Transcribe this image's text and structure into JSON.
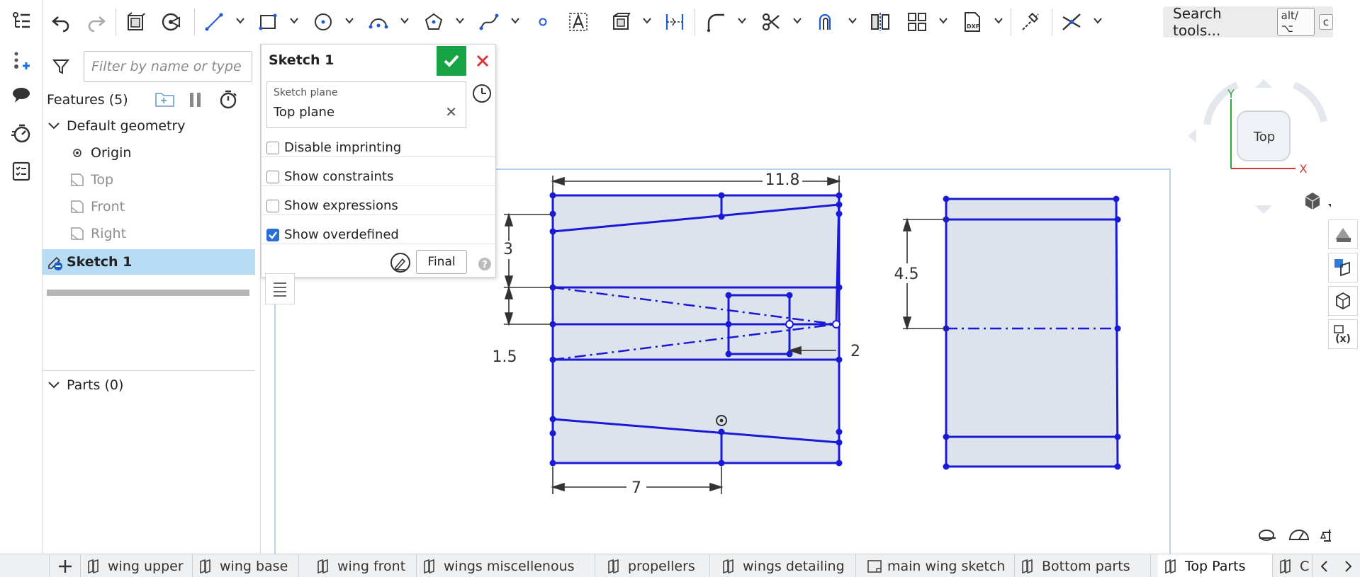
{
  "rail": {
    "items": [
      "feature-list",
      "insert",
      "comments",
      "performance",
      "parts-checklist"
    ]
  },
  "toolbar": {
    "search_label": "Search tools...",
    "search_shortcut_mod": "alt/⌥",
    "search_shortcut_key": "c"
  },
  "feature_panel": {
    "filter_placeholder": "Filter by name or type",
    "features_title": "Features (5)",
    "default_geometry": "Default geometry",
    "origin": "Origin",
    "planes": [
      "Top",
      "Front",
      "Right"
    ],
    "sketch": "Sketch 1",
    "parts_title": "Parts (0)"
  },
  "sketch_dialog": {
    "title": "Sketch 1",
    "plane_label": "Sketch plane",
    "plane_value": "Top plane",
    "options": [
      {
        "label": "Disable imprinting",
        "checked": false
      },
      {
        "label": "Show constraints",
        "checked": false
      },
      {
        "label": "Show expressions",
        "checked": false
      },
      {
        "label": "Show overdefined",
        "checked": true
      }
    ],
    "final_label": "Final"
  },
  "view_cube": {
    "face": "Top",
    "axis_y": "Y",
    "axis_x": "X"
  },
  "dimensions": {
    "width_top": "11.8",
    "left_3": "3",
    "left_1_5": "1.5",
    "right_2": "2",
    "bottom_7": "7",
    "right_view_4_5": "4.5"
  },
  "tabs": [
    {
      "label": "wing upper",
      "icon": "part-studio-icon"
    },
    {
      "label": "wing base",
      "icon": "part-studio-icon"
    },
    {
      "label": "wing front",
      "icon": "part-studio-icon"
    },
    {
      "label": "wings miscellenous",
      "icon": "part-studio-icon"
    },
    {
      "label": "propellers",
      "icon": "part-studio-icon"
    },
    {
      "label": "wings detailing",
      "icon": "part-studio-icon"
    },
    {
      "label": "main wing sketch",
      "icon": "drawing-icon"
    },
    {
      "label": "Bottom parts",
      "icon": "part-studio-icon"
    },
    {
      "label": "Top Parts",
      "icon": "part-studio-icon",
      "active": true
    },
    {
      "label": "C",
      "icon": "part-studio-icon"
    }
  ],
  "colors": {
    "sketch_blue": "#1a1ad6",
    "region_fill": "#dde3ec",
    "selection": "#b9dcf5",
    "ok_green": "#17a244",
    "cancel_red": "#d43535"
  }
}
